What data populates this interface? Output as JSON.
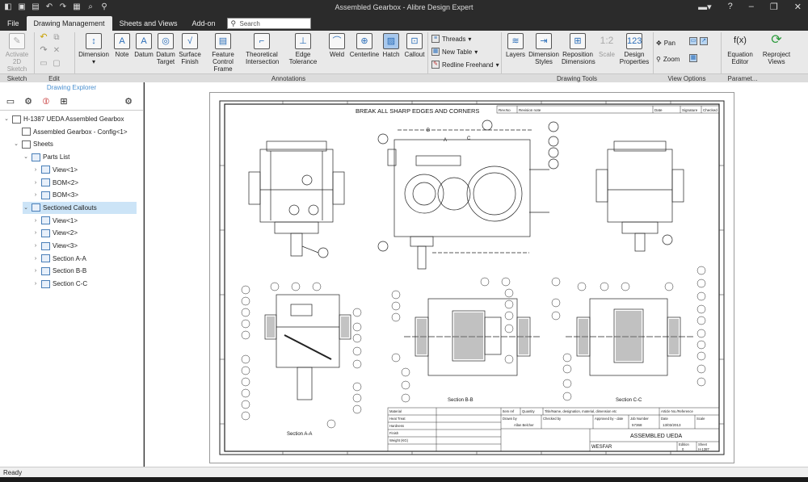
{
  "window": {
    "title": "Assembled Gearbox - Alibre Design Expert"
  },
  "menu": {
    "file": "File",
    "tabs": [
      "Drawing Management",
      "Sheets and Views",
      "Add-on"
    ],
    "search_placeholder": "Search"
  },
  "ribbon": {
    "buttons": {
      "activate": "Activate 2D Sketch",
      "dimension": "Dimension",
      "note": "Note",
      "datum": "Datum",
      "datum_target": "Datum Target",
      "surface_finish": "Surface Finish",
      "feature_control": "Feature Control Frame",
      "theoretical": "Theoretical Intersection",
      "edge_tolerance": "Edge Tolerance",
      "weld": "Weld",
      "centerline": "Centerline",
      "hatch": "Hatch",
      "callout": "Callout",
      "threads": "Threads",
      "new_table": "New Table",
      "redline": "Redline Freehand",
      "layers": "Layers",
      "dimension_styles": "Dimension Styles",
      "reposition": "Reposition Dimensions",
      "scale": "Scale",
      "design_properties": "Design Properties",
      "pan": "Pan",
      "zoom": "Zoom",
      "equation_editor": "Equation Editor",
      "reproject": "Reproject Views"
    },
    "groups": {
      "sketch": "Sketch",
      "edit": "Edit",
      "annotations": "Annotations",
      "drawing_tools": "Drawing Tools",
      "view_options": "View Options",
      "parameters": "Paramet..."
    }
  },
  "explorer": {
    "title": "Drawing Explorer",
    "tree": [
      {
        "label": "H-1387 UEDA Assembled Gearbox",
        "level": 0,
        "twisty": "v"
      },
      {
        "label": "Assembled Gearbox - Config<1>",
        "level": 1,
        "twisty": ""
      },
      {
        "label": "Sheets",
        "level": 1,
        "twisty": "v"
      },
      {
        "label": "Parts List",
        "level": 2,
        "twisty": "v"
      },
      {
        "label": "View<1>",
        "level": 3,
        "twisty": ">"
      },
      {
        "label": "BOM<2>",
        "level": 3,
        "twisty": ">"
      },
      {
        "label": "BOM<3>",
        "level": 3,
        "twisty": ">"
      },
      {
        "label": "Sectioned Callouts",
        "level": 2,
        "twisty": "v",
        "selected": true
      },
      {
        "label": "View<1>",
        "level": 3,
        "twisty": ">"
      },
      {
        "label": "View<2>",
        "level": 3,
        "twisty": ">"
      },
      {
        "label": "View<3>",
        "level": 3,
        "twisty": ">"
      },
      {
        "label": "Section A-A",
        "level": 3,
        "twisty": ">"
      },
      {
        "label": "Section B-B",
        "level": 3,
        "twisty": ">"
      },
      {
        "label": "Section C-C",
        "level": 3,
        "twisty": ">"
      }
    ]
  },
  "drawing": {
    "note_top": "BREAK ALL SHARP EDGES AND CORNERS",
    "revision_header": [
      "Rev.No",
      "Revision note",
      "Date",
      "Signature",
      "Checked"
    ],
    "section_labels": [
      "Section A-A",
      "Section B-B",
      "Section C-C"
    ],
    "cut_labels": [
      "A",
      "B",
      "C"
    ],
    "title_block": {
      "title": "ASSEMBLED UEDA",
      "company": "WESFAR",
      "drawn_by_label": "Drawn by",
      "drawn_by": "Allan Belcher",
      "checked_by_label": "Checked by",
      "approved_label": "Approved by - date",
      "job_number_label": "Job Number",
      "job_number": "57368",
      "date_label": "Date",
      "date": "13/03/2013",
      "scale_label": "Scale",
      "edition_label": "Edition",
      "edition": "0",
      "sheet_label": "Sheet",
      "sheet": "H-1387",
      "article_label": "Article No./Reference",
      "quantity_label": "Quantity",
      "itemref_label": "Item ref",
      "title_header": "Title/Name, designation, material, dimension etc"
    },
    "material_rows": [
      "Material",
      "Heat Treat",
      "Hardness",
      "Finish",
      "Weight (KG)"
    ]
  },
  "status": {
    "text": "Ready"
  }
}
